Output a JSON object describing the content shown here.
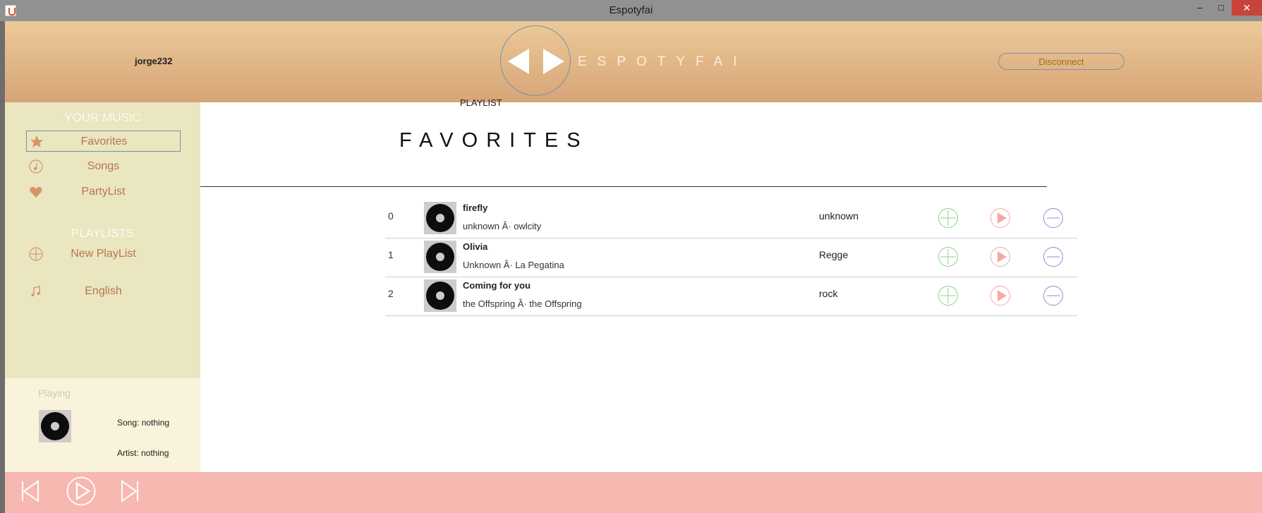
{
  "window": {
    "title": "Espotyfai",
    "min_glyph": "–",
    "max_glyph": "□",
    "close_glyph": "✕"
  },
  "header": {
    "username": "jorge232",
    "brand": "ESPOTYFAI",
    "disconnect_label": "Disconnect"
  },
  "sidebar": {
    "your_music_title": "YOUR MUSIC",
    "items": [
      {
        "label": "Favorites",
        "icon": "star-icon",
        "active": true
      },
      {
        "label": "Songs",
        "icon": "music-note-icon"
      },
      {
        "label": "PartyList",
        "icon": "heart-icon"
      }
    ],
    "playlists_title": "PLAYLISTS",
    "playlist_items": [
      {
        "label": "New PlayList",
        "icon": "plus-circle-icon"
      },
      {
        "label": "English",
        "icon": "music-notes-icon"
      }
    ]
  },
  "now_playing": {
    "title": "Playing",
    "song": "Song: nothing",
    "artist": "Artist: nothing"
  },
  "main": {
    "section_label": "PLAYLIST",
    "playlist_name": "FAVORITES",
    "tracks": [
      {
        "index": "0",
        "title": "firefly",
        "subtitle": "unknown Â· owlcity",
        "genre": "unknown"
      },
      {
        "index": "1",
        "title": "Olivia",
        "subtitle": "Unknown Â· La Pegatina",
        "genre": "Regge"
      },
      {
        "index": "2",
        "title": "Coming for you",
        "subtitle": "the Offspring Â· the Offspring",
        "genre": "rock"
      }
    ]
  },
  "colors": {
    "header_top": "#ecc999",
    "header_bottom": "#d7a577",
    "sidebar_bg": "#e9e6c0",
    "now_playing_bg": "#f9f3db",
    "player_bg": "#f7b8b1",
    "accent_orange": "#d4956a",
    "add_green": "#8fd08a",
    "play_pink": "#f6a9a2",
    "remove_purple": "#9a86d8"
  }
}
